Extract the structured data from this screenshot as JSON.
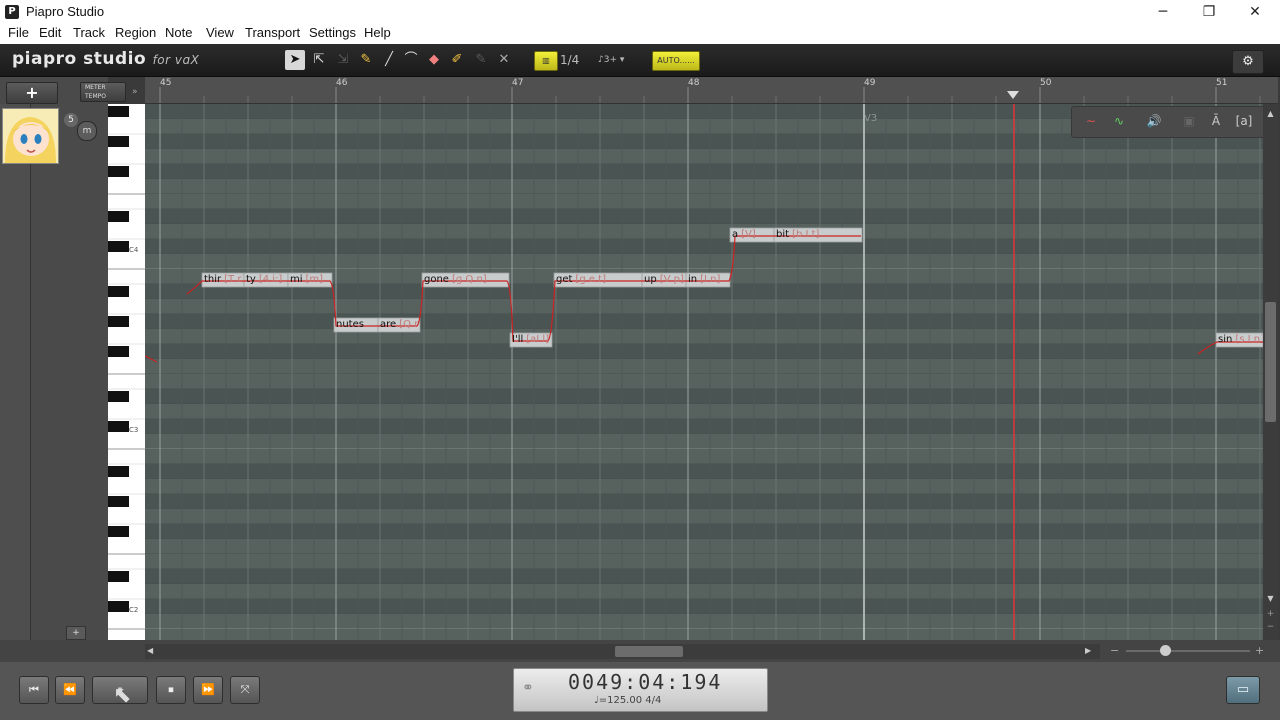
{
  "window": {
    "title": "Piapro Studio",
    "minimize": "─",
    "restore": "❐",
    "close": "✕"
  },
  "menu": [
    "File",
    "Edit",
    "Track",
    "Region",
    "Note",
    "View",
    "Transport",
    "Settings",
    "Help"
  ],
  "toolbar": {
    "logo": "piapro studio",
    "logo_suffix": "for vɑX",
    "quantize": "1/4",
    "quantize_extra": "♪3+",
    "auto_label": "AUTO......",
    "tools": [
      "pointer-tool",
      "multi-select-tool",
      "select-dim-tool",
      "pencil-tool",
      "line-tool",
      "curve-tool",
      "eraser-tool",
      "brush-tool",
      "dim-tool",
      "delete-tool"
    ]
  },
  "left_panel": {
    "add": "+",
    "meter": "METER",
    "tempo": "TEMPO",
    "expand": "»",
    "track_number": "5",
    "track_button": "m",
    "add_small": "+"
  },
  "ruler": {
    "bars": [
      "45",
      "46",
      "47",
      "48",
      "49",
      "50",
      "51"
    ]
  },
  "keyboard": {
    "labels": [
      "C4",
      "C3",
      "C2"
    ]
  },
  "grid": {
    "region_label": "V3",
    "notes": [
      {
        "lyric": "thir",
        "phoneme": "[T r]"
      },
      {
        "lyric": "ty",
        "phoneme": "[4 i:]"
      },
      {
        "lyric": "mi",
        "phoneme": "[m]"
      },
      {
        "lyric": "nutes",
        "phoneme": ""
      },
      {
        "lyric": "are",
        "phoneme": "[Q r]"
      },
      {
        "lyric": "gone",
        "phoneme": "[g Q n]"
      },
      {
        "lyric": "I'll",
        "phoneme": "[aI l]"
      },
      {
        "lyric": "get",
        "phoneme": "[g e t]"
      },
      {
        "lyric": "up",
        "phoneme": "[V p]"
      },
      {
        "lyric": "in",
        "phoneme": "[I n]"
      },
      {
        "lyric": "a",
        "phoneme": "[V]"
      },
      {
        "lyric": "bit",
        "phoneme": "[b I t]"
      },
      {
        "lyric": "sin",
        "phoneme": "[s I n]"
      }
    ]
  },
  "panel_tools": [
    "pitch-icon",
    "dynamics-icon",
    "volume-icon",
    "lock-icon",
    "translate-icon",
    "phoneme-icon"
  ],
  "transport": {
    "time": "0049:04:194",
    "tempo": "♩=125.00  4/4",
    "buttons": [
      "⏮",
      "⏪",
      "⏸",
      "⏹",
      "⏩",
      "⤧"
    ]
  },
  "colors": {
    "accent_yellow": "#e5e02c",
    "playhead": "#e0353a",
    "grid_bg": "#505b58",
    "note_fill": "#c9cccc",
    "pitch_line": "#cc2222"
  }
}
